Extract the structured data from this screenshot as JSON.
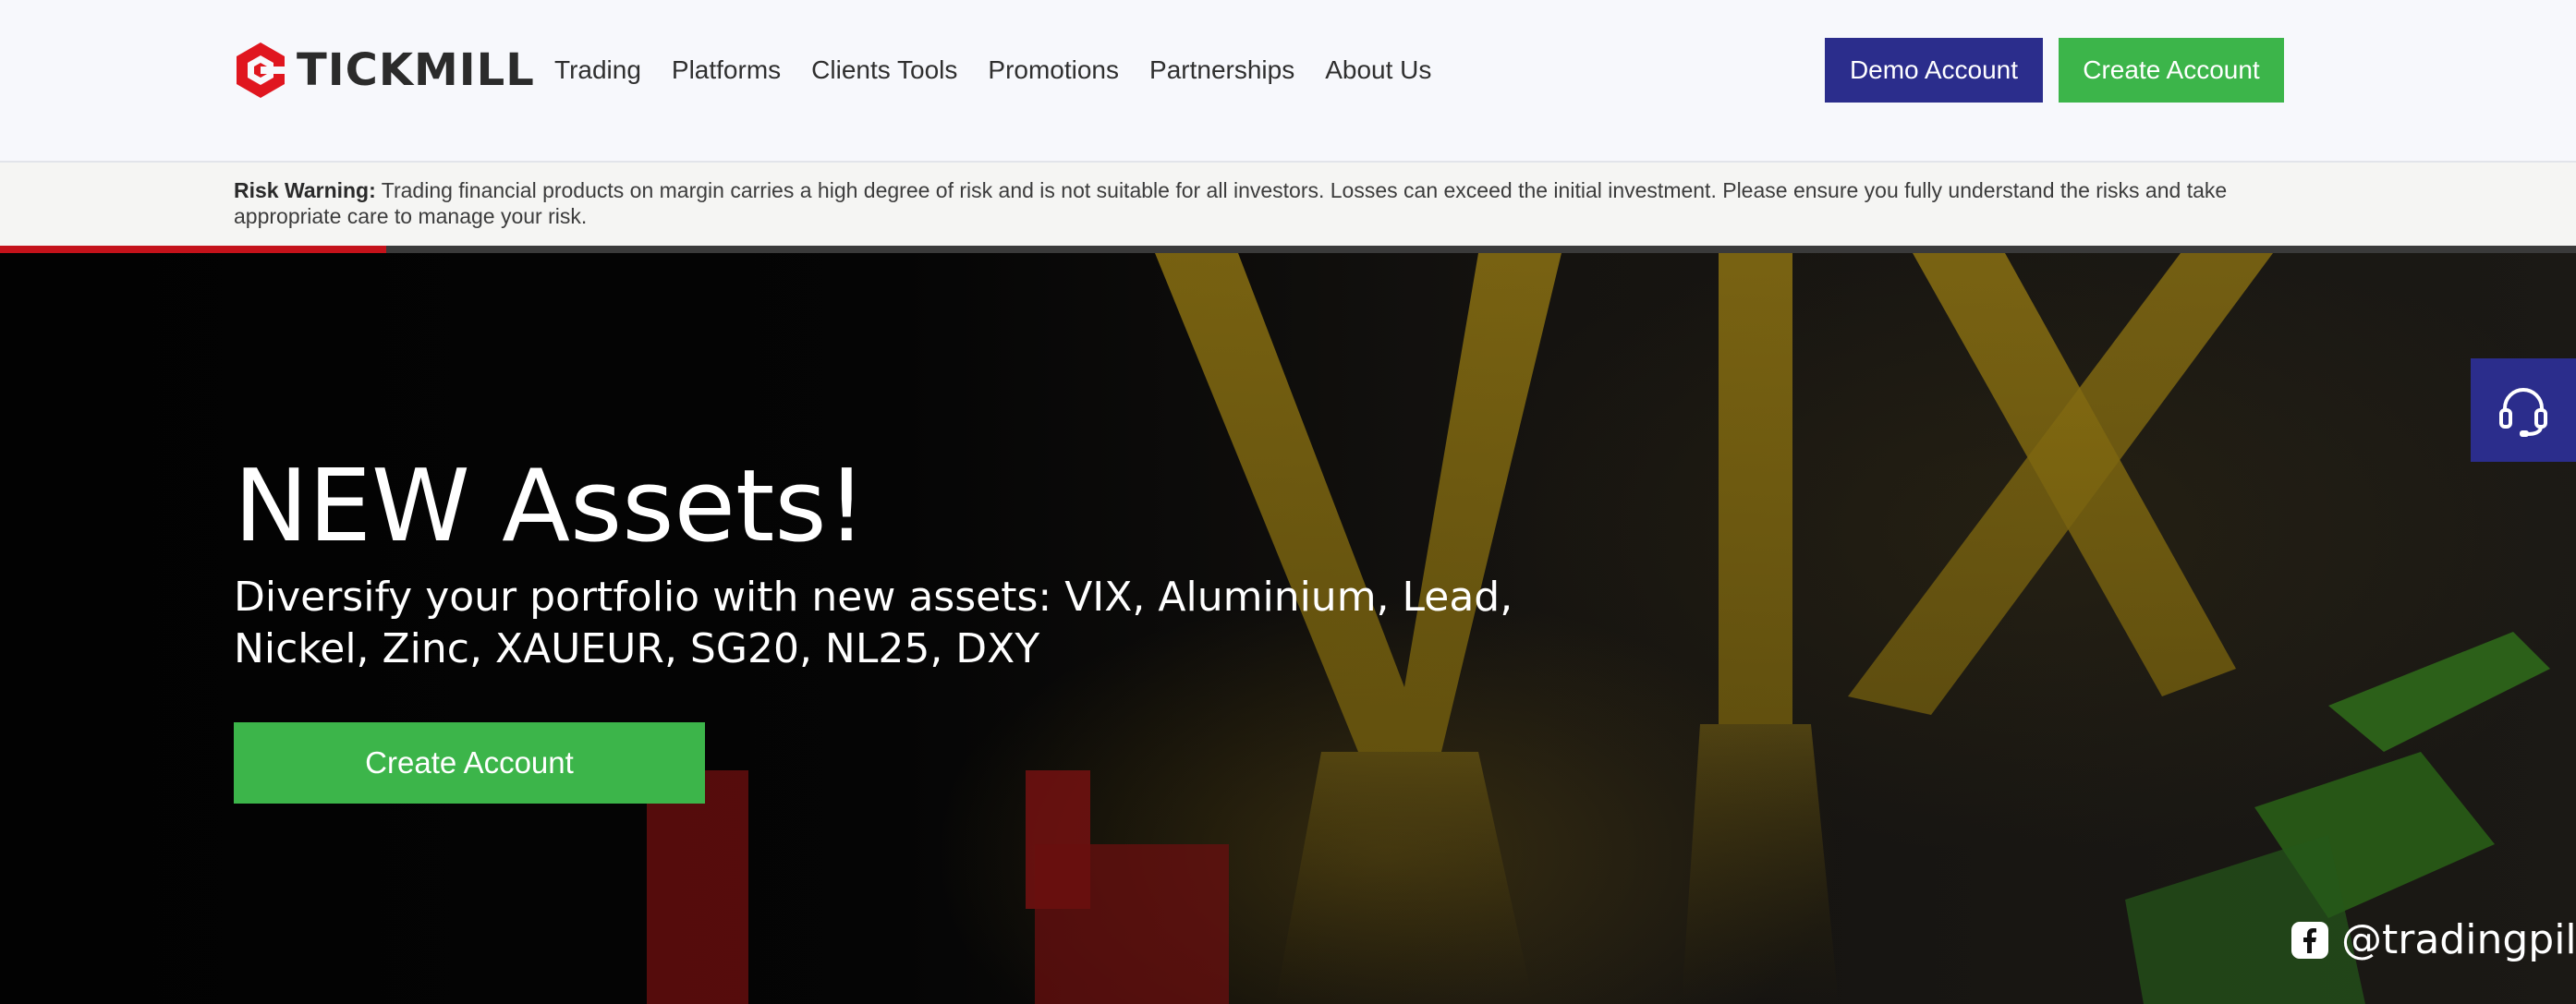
{
  "brand": {
    "name": "TICKMILL"
  },
  "nav": {
    "items": [
      {
        "label": "Trading"
      },
      {
        "label": "Platforms"
      },
      {
        "label": "Clients Tools"
      },
      {
        "label": "Promotions"
      },
      {
        "label": "Partnerships"
      },
      {
        "label": "About Us"
      }
    ]
  },
  "header_buttons": {
    "demo": "Demo Account",
    "create": "Create Account"
  },
  "risk": {
    "title": "Risk Warning:",
    "text": "Trading financial products on margin carries a high degree of risk and is not suitable for all investors. Losses can exceed the initial investment. Please ensure you fully understand the risks and take appropriate care to manage your risk."
  },
  "slider": {
    "progress": 0.15
  },
  "hero": {
    "title": "NEW Assets!",
    "subtitle": "Diversify your portfolio with new assets: VIX, Aluminium, Lead, Nickel, Zinc, XAUEUR, SG20, NL25, DXY",
    "cta": "Create Account",
    "art_letters": "VIX"
  },
  "support": {
    "icon": "headset-icon"
  },
  "watermark": {
    "handle": "@tradingpill",
    "icon": "facebook-icon"
  },
  "colors": {
    "brand_red": "#e0161f",
    "demo_blue": "#2b2d8c",
    "cta_green": "#3cb54a",
    "progress_red": "#c4121a",
    "vix_gold": "#a88a14"
  }
}
